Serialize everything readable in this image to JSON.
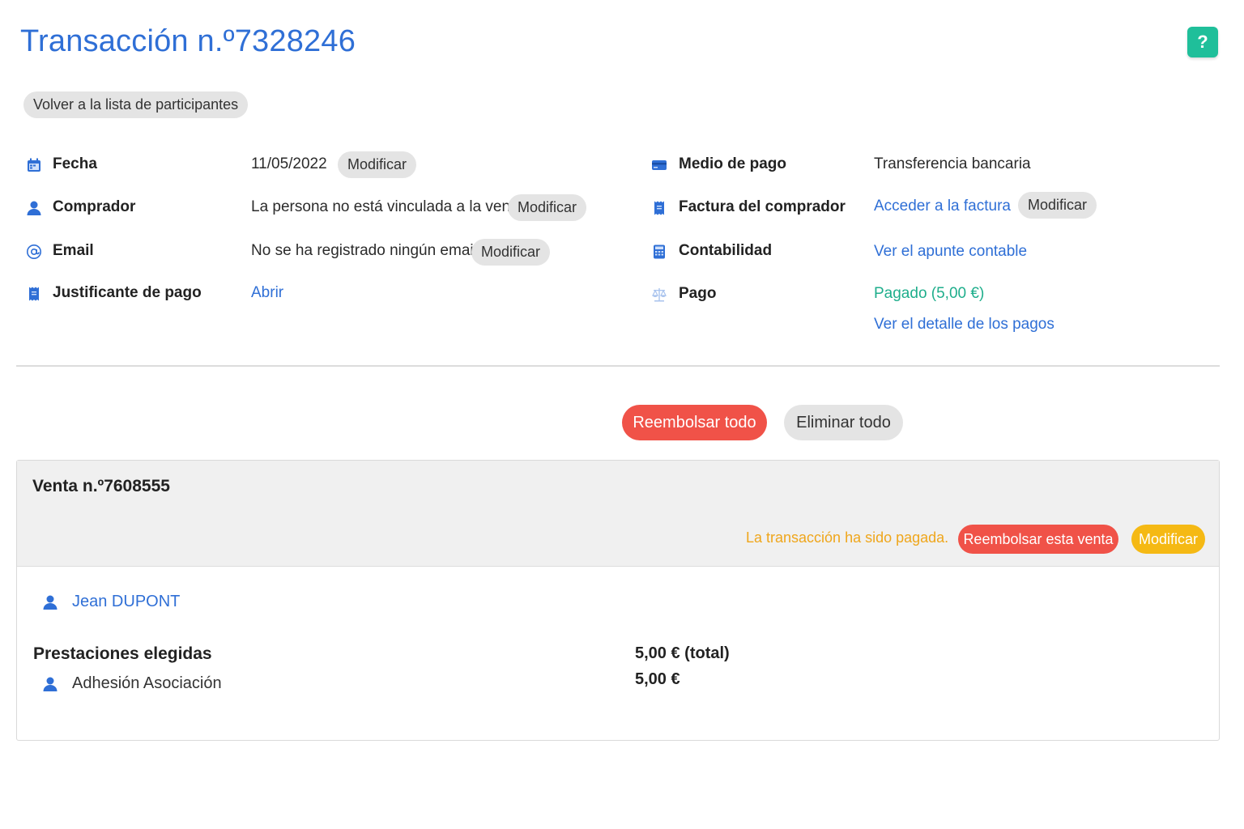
{
  "header": {
    "title": "Transacción n.º7328246",
    "help_label": "?"
  },
  "back_button": "Volver a la lista de participantes",
  "details_left": {
    "fecha": {
      "label": "Fecha",
      "value": "11/05/2022",
      "action": "Modificar"
    },
    "comprador": {
      "label": "Comprador",
      "value": "La persona no está vinculada a la venta",
      "action": "Modificar"
    },
    "email": {
      "label": "Email",
      "value": "No se ha registrado ningún email.",
      "action": "Modificar"
    },
    "justificante": {
      "label": "Justificante de pago",
      "link": "Abrir"
    }
  },
  "details_right": {
    "medio": {
      "label": "Medio de pago",
      "value": "Transferencia bancaria"
    },
    "factura": {
      "label": "Factura del comprador",
      "link": "Acceder a la factura",
      "action": "Modificar"
    },
    "contabilidad": {
      "label": "Contabilidad",
      "link": "Ver el apunte contable"
    },
    "pago": {
      "label": "Pago",
      "status": "Pagado (5,00 €)",
      "link": "Ver el detalle de los pagos"
    }
  },
  "actions": {
    "refund_all": "Reembolsar todo",
    "delete_all": "Eliminar todo"
  },
  "sale": {
    "title": "Venta n.º7608555",
    "paid_note": "La transacción ha sido pagada.",
    "refund_label": "Reembolsar esta venta",
    "modify_label": "Modificar",
    "person": "Jean DUPONT",
    "prestaciones_title": "Prestaciones elegidas",
    "total": "5,00 € (total)",
    "items": [
      {
        "name": "Adhesión Asociación",
        "price": "5,00 €"
      }
    ]
  },
  "colors": {
    "accent_blue": "#2f6fd6",
    "success_green": "#1fae8c",
    "danger_red": "#f05248",
    "warning_yellow": "#f5b914",
    "help_teal": "#1fbf9a"
  }
}
